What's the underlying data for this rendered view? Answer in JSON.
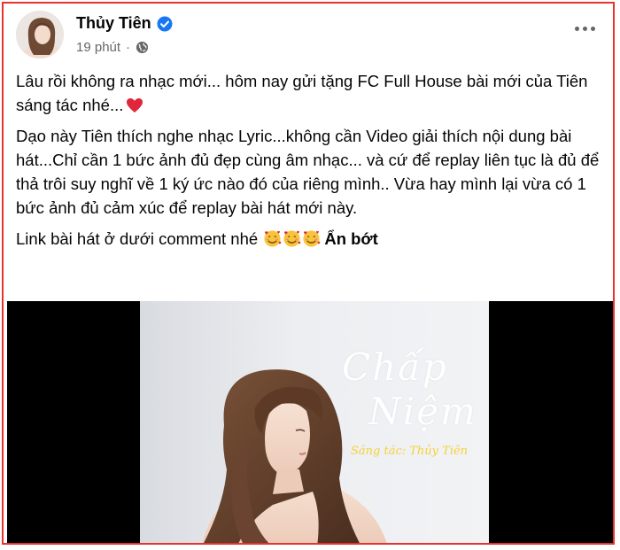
{
  "post": {
    "author": "Thủy Tiên",
    "time": "19 phút",
    "separator": "·",
    "paragraphs": [
      "Lâu rồi không ra nhạc mới... hôm nay gửi tặng FC Full House bài mới của Tiên sáng tác nhé...",
      "Dạo này Tiên thích nghe nhạc Lyric...không cần Video giải thích nội dung bài hát...Chỉ cần 1 bức ảnh đủ đẹp cùng âm nhạc... và cứ để replay liên tục là đủ để thả trôi suy nghĩ về 1 ký ức nào đó của riêng mình.. Vừa hay mình lại vừa có 1 bức ảnh đủ cảm xúc để replay bài hát mới này.",
      "Link bài hát ở dưới comment nhé"
    ],
    "see_less": "Ẩn bớt",
    "icons": {
      "verified": "verified-badge-icon",
      "privacy": "globe-icon",
      "more": "more-options-icon",
      "heart": "red-heart-emoji",
      "emoji": "smiling-face-with-hearts-emoji"
    }
  },
  "media": {
    "song_title_line1": "Chấp",
    "song_title_line2": "Niệm",
    "credit": "Sáng tác: Thủy Tiên"
  },
  "colors": {
    "border": "#e8322f",
    "verified": "#1877f2",
    "meta": "#65676b",
    "credit": "#f3d23a"
  }
}
